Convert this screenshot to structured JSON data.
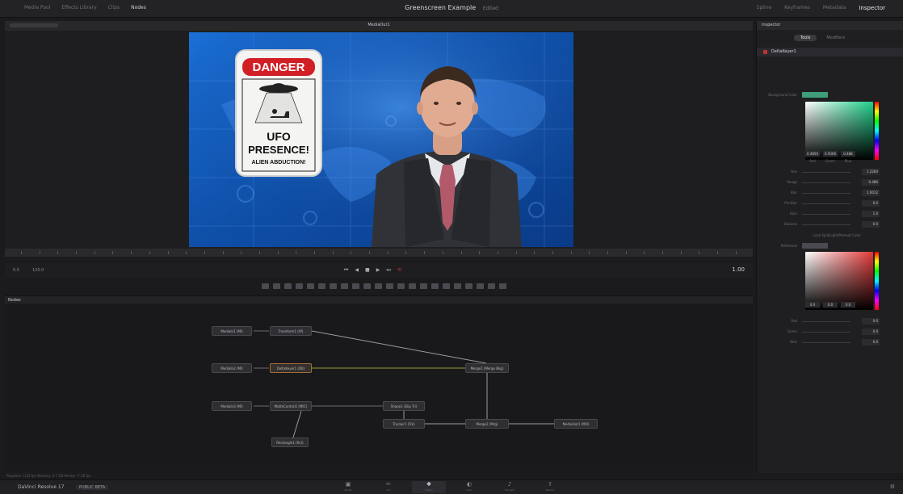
{
  "titlebar": {
    "left": [
      "Media Pool",
      "Effects Library",
      "Clips",
      "Nodes"
    ],
    "title": "Greenscreen Example",
    "title_status": "Edited",
    "right": [
      "Spline",
      "Keyframes",
      "Metadata",
      "Inspector"
    ]
  },
  "viewer": {
    "name": "MediaOut1",
    "sign": {
      "danger": "DANGER",
      "line1": "UFO",
      "line2": "PRESENCE!",
      "line3": "ALIEN ABDUCTION!"
    }
  },
  "transport": {
    "left_a": "0.0",
    "left_b": "120.0",
    "timecode": "1.00"
  },
  "nodes": {
    "panel_title": "Nodes",
    "items": [
      "MediaIn1 (MI)",
      "Transform1 (Xf)",
      "MediaIn2 (MI)",
      "DeltaKeyer1 (DK)",
      "Merge1 (Merge Bkg)",
      "MediaIn3 (MI)",
      "MatteControl1 (MtC)",
      "Shape1 (Elip Tri)",
      "Tracker1 (Trk)",
      "Rectangle1 (Rct)",
      "Merge2 (Mrg)",
      "MediaOut1 (MO)"
    ]
  },
  "inspector": {
    "panel_title": "Inspector",
    "tabs": [
      "Tools",
      "Modifiers"
    ],
    "node_name": "DeltaKeyer1",
    "background_label": "Background Color",
    "rgb_values": [
      "0.4856",
      "0.9306",
      "0.488"
    ],
    "rgb_labels": [
      "Red",
      "Green",
      "Blue"
    ],
    "params": [
      {
        "label": "Hue",
        "value": "1.2284"
      },
      {
        "label": "Range",
        "value": "0.486"
      },
      {
        "label": "Blur",
        "value": "1.0012"
      },
      {
        "label": "Pre-Blur",
        "value": "0.0"
      },
      {
        "label": "Gain",
        "value": "1.0"
      },
      {
        "label": "Balance",
        "value": "0.0"
      }
    ],
    "lock_label": "Lock Spill/Light/Premult Color",
    "reference_label": "Reference",
    "ref_values": [
      "0.0",
      "0.0",
      "0.0"
    ],
    "ref_params": [
      {
        "label": "Red",
        "value": "0.0"
      },
      {
        "label": "Green",
        "value": "0.0"
      },
      {
        "label": "Blue",
        "value": "0.0"
      }
    ]
  },
  "status": {
    "text": "Playback: 1/24 fps   Memory: 4.7 GB   Render: 7.58 fps"
  },
  "pagebar": {
    "project": "DaVinci Resolve 17",
    "project_badge": "PUBLIC BETA",
    "pages": [
      {
        "icon": "media-icon",
        "label": "Media"
      },
      {
        "icon": "cut-icon",
        "label": "Cut"
      },
      {
        "icon": "fusion-icon",
        "label": "Fusion"
      },
      {
        "icon": "color-icon",
        "label": "Color"
      },
      {
        "icon": "fairlight-icon",
        "label": "Fairlight"
      },
      {
        "icon": "deliver-icon",
        "label": "Deliver"
      }
    ]
  },
  "colors": {
    "accent_red": "#d23a3a",
    "selection": "#a06d3c"
  }
}
